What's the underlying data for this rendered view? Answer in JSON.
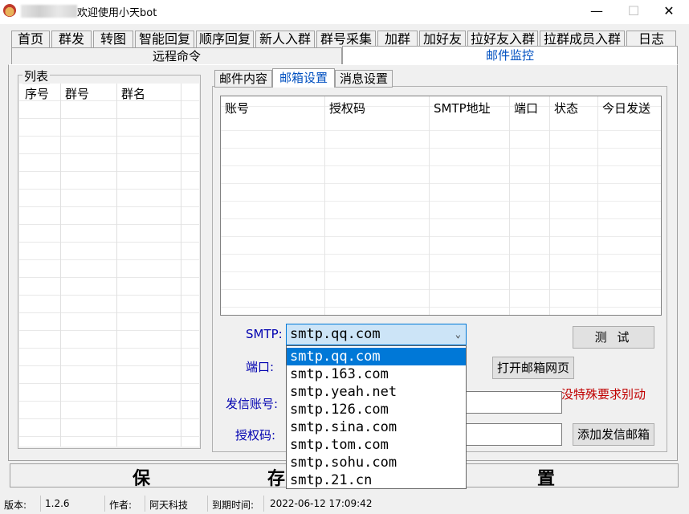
{
  "window": {
    "title": "欢迎使用小天bot",
    "controls": [
      "—",
      "☐",
      "✕"
    ]
  },
  "tabs_row1": [
    "首页",
    "群发",
    "转图",
    "智能回复",
    "顺序回复",
    "新人入群",
    "群号采集",
    "加群",
    "加好友",
    "拉好友入群",
    "拉群成员入群",
    "日志"
  ],
  "tabs_row2": [
    "远程命令",
    "邮件监控"
  ],
  "left_group": {
    "label": "列表",
    "headers": [
      "序号",
      "群号",
      "群名"
    ]
  },
  "sub_tabs": [
    "邮件内容",
    "邮箱设置",
    "消息设置"
  ],
  "mail_table": {
    "headers": [
      "账号",
      "授权码",
      "SMTP地址",
      "端口",
      "状态",
      "今日发送"
    ]
  },
  "form": {
    "smtp_label": "SMTP:",
    "smtp_value": "smtp.qq.com",
    "port_label": "端口:",
    "account_label": "发信账号:",
    "auth_label": "授权码:",
    "test_button": "测  试",
    "open_web_button": "打开邮箱网页",
    "hint": "没特殊要求别动",
    "add_button": "添加发信邮箱"
  },
  "smtp_options": [
    "smtp.qq.com",
    "smtp.163.com",
    "smtp.yeah.net",
    "smtp.126.com",
    "smtp.sina.com",
    "smtp.tom.com",
    "smtp.sohu.com",
    "smtp.21.cn"
  ],
  "save_bar": [
    "保",
    "存",
    "置"
  ],
  "status": {
    "version_label": "版本:",
    "version": "1.2.6",
    "author_label": "作者:",
    "author": "阿天科技",
    "expire_label": "到期时间:",
    "expire": "2022-06-12 17:09:42"
  },
  "colors": {
    "accent": "#0078d7",
    "hint": "#c00000",
    "label": "#0000b0"
  }
}
